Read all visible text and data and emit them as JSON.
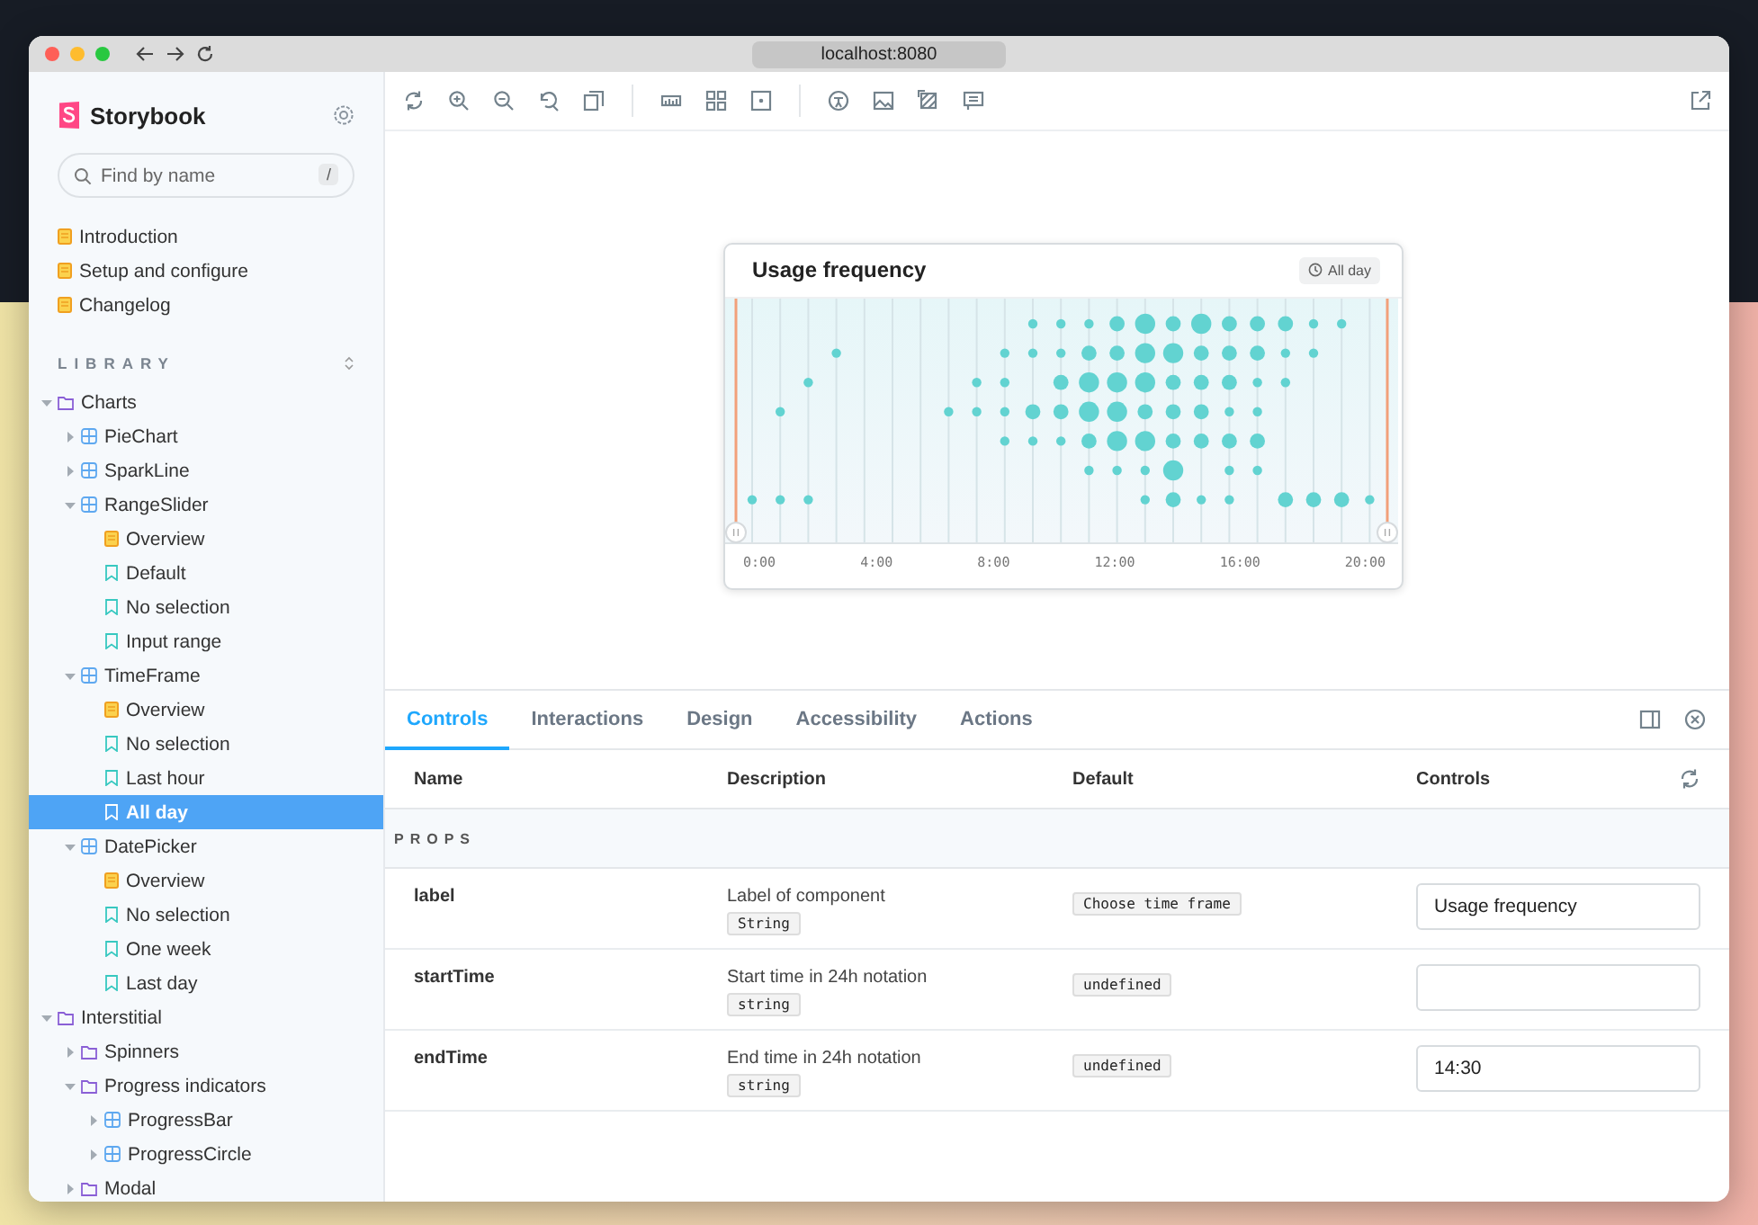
{
  "browser": {
    "url": "localhost:8080"
  },
  "sidebar": {
    "brand": "Storybook",
    "search": {
      "placeholder": "Find by name",
      "shortcut": "/"
    },
    "docs": [
      {
        "label": "Introduction",
        "selected": false
      },
      {
        "label": "Setup and configure",
        "selected": false
      },
      {
        "label": "Changelog",
        "selected": false
      }
    ],
    "section_title": "LIBRARY",
    "tree": [
      {
        "label": "Charts",
        "kind": "group",
        "expanded": true,
        "selected": false,
        "children": [
          {
            "label": "PieChart",
            "kind": "component",
            "expanded": false,
            "selected": false
          },
          {
            "label": "SparkLine",
            "kind": "component",
            "expanded": false,
            "selected": false
          },
          {
            "label": "RangeSlider",
            "kind": "component",
            "expanded": true,
            "selected": false,
            "children": [
              {
                "label": "Overview",
                "kind": "docs",
                "selected": false
              },
              {
                "label": "Default",
                "kind": "story",
                "selected": false
              },
              {
                "label": "No selection",
                "kind": "story",
                "selected": false
              },
              {
                "label": "Input range",
                "kind": "story",
                "selected": false
              }
            ]
          },
          {
            "label": "TimeFrame",
            "kind": "component",
            "expanded": true,
            "selected": false,
            "children": [
              {
                "label": "Overview",
                "kind": "docs",
                "selected": false
              },
              {
                "label": "No selection",
                "kind": "story",
                "selected": false
              },
              {
                "label": "Last hour",
                "kind": "story",
                "selected": false
              },
              {
                "label": "All day",
                "kind": "story",
                "selected": true
              }
            ]
          },
          {
            "label": "DatePicker",
            "kind": "component",
            "expanded": true,
            "selected": false,
            "children": [
              {
                "label": "Overview",
                "kind": "docs",
                "selected": false
              },
              {
                "label": "No selection",
                "kind": "story",
                "selected": false
              },
              {
                "label": "One week",
                "kind": "story",
                "selected": false
              },
              {
                "label": "Last day",
                "kind": "story",
                "selected": false
              }
            ]
          }
        ]
      },
      {
        "label": "Interstitial",
        "kind": "group",
        "expanded": true,
        "selected": false,
        "children": [
          {
            "label": "Spinners",
            "kind": "group",
            "expanded": false,
            "selected": false
          },
          {
            "label": "Progress indicators",
            "kind": "group",
            "expanded": true,
            "selected": false,
            "children": [
              {
                "label": "ProgressBar",
                "kind": "component",
                "expanded": false,
                "selected": false
              },
              {
                "label": "ProgressCircle",
                "kind": "component",
                "expanded": false,
                "selected": false
              }
            ]
          },
          {
            "label": "Modal",
            "kind": "group",
            "expanded": false,
            "selected": false
          }
        ]
      }
    ]
  },
  "preview": {
    "card": {
      "title": "Usage frequency",
      "badge": "All day",
      "axis_labels": [
        "0:00",
        "4:00",
        "8:00",
        "12:00",
        "16:00",
        "20:00"
      ]
    }
  },
  "panel": {
    "tabs": [
      {
        "label": "Controls",
        "selected": true
      },
      {
        "label": "Interactions",
        "selected": false
      },
      {
        "label": "Design",
        "selected": false
      },
      {
        "label": "Accessibility",
        "selected": false
      },
      {
        "label": "Actions",
        "selected": false
      }
    ],
    "columns": [
      "Name",
      "Description",
      "Default",
      "Controls"
    ],
    "section": "PROPS",
    "rows": [
      {
        "name": "label",
        "description": "Label of component",
        "type": "String",
        "default": "Choose time frame",
        "control": {
          "value": "Usage frequency"
        }
      },
      {
        "name": "startTime",
        "description": "Start time in 24h notation",
        "type": "string",
        "default": "undefined",
        "control": {}
      },
      {
        "name": "endTime",
        "description": "End time in 24h notation",
        "type": "string",
        "default": "undefined",
        "control": {
          "value": "14:30"
        }
      }
    ]
  }
}
